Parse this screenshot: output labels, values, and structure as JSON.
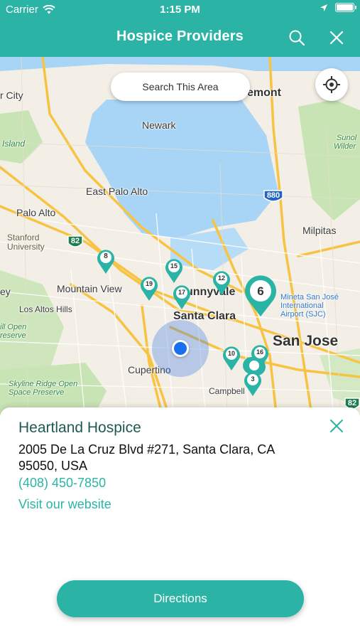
{
  "status_bar": {
    "carrier": "Carrier",
    "time": "1:15 PM"
  },
  "nav": {
    "title": "Hospice Providers",
    "search_icon": "search-icon",
    "close_icon": "close-icon"
  },
  "map": {
    "search_area_label": "Search This Area",
    "locate_icon": "crosshair-icon",
    "labels": {
      "redwood_city": "r City",
      "newark": "Newark",
      "fremont": "emont",
      "island": "Island",
      "sunol": "Sunol",
      "wilderness": "Wilder",
      "east_palo_alto": "East Palo Alto",
      "palo_alto": "Palo Alto",
      "milpitas": "Milpitas",
      "stanford": "Stanford\nUniversity",
      "mountain_view": "Mountain View",
      "sunnyvale": "unnyvale",
      "mineta": "Mineta San José\nInternational\nAirport (SJC)",
      "los_altos_hills": "Los Altos Hills",
      "santa_clara": "Santa Clara",
      "san_jose": "San Jose",
      "hill_open": "ill Open\nreserve",
      "ey": "ey",
      "cupertino": "Cupertino",
      "skyline": "Skyline Ridge Open\nSpace Preserve",
      "campbell": "Campbell"
    },
    "highway_shields": [
      "880",
      "82",
      "82"
    ],
    "pins": [
      {
        "label": "8"
      },
      {
        "label": "15"
      },
      {
        "label": "19"
      },
      {
        "label": "17"
      },
      {
        "label": "12"
      },
      {
        "label": "6"
      },
      {
        "label": "10"
      },
      {
        "label": "16"
      },
      {
        "label": "3"
      }
    ],
    "colors": {
      "pin": "#2bb4a6",
      "water": "#a8d4f5",
      "land": "#f3efe6",
      "park": "#c8e3b4"
    }
  },
  "provider": {
    "name": "Heartland Hospice",
    "address": "2005 De La Cruz Blvd #271, Santa Clara, CA 95050, USA",
    "phone": "(408) 450-7850",
    "website_label": "Visit our website",
    "close_icon": "close-icon"
  },
  "actions": {
    "directions_label": "Directions"
  },
  "colors": {
    "brand": "#2bb4a6",
    "title_text": "#1e5a52"
  }
}
